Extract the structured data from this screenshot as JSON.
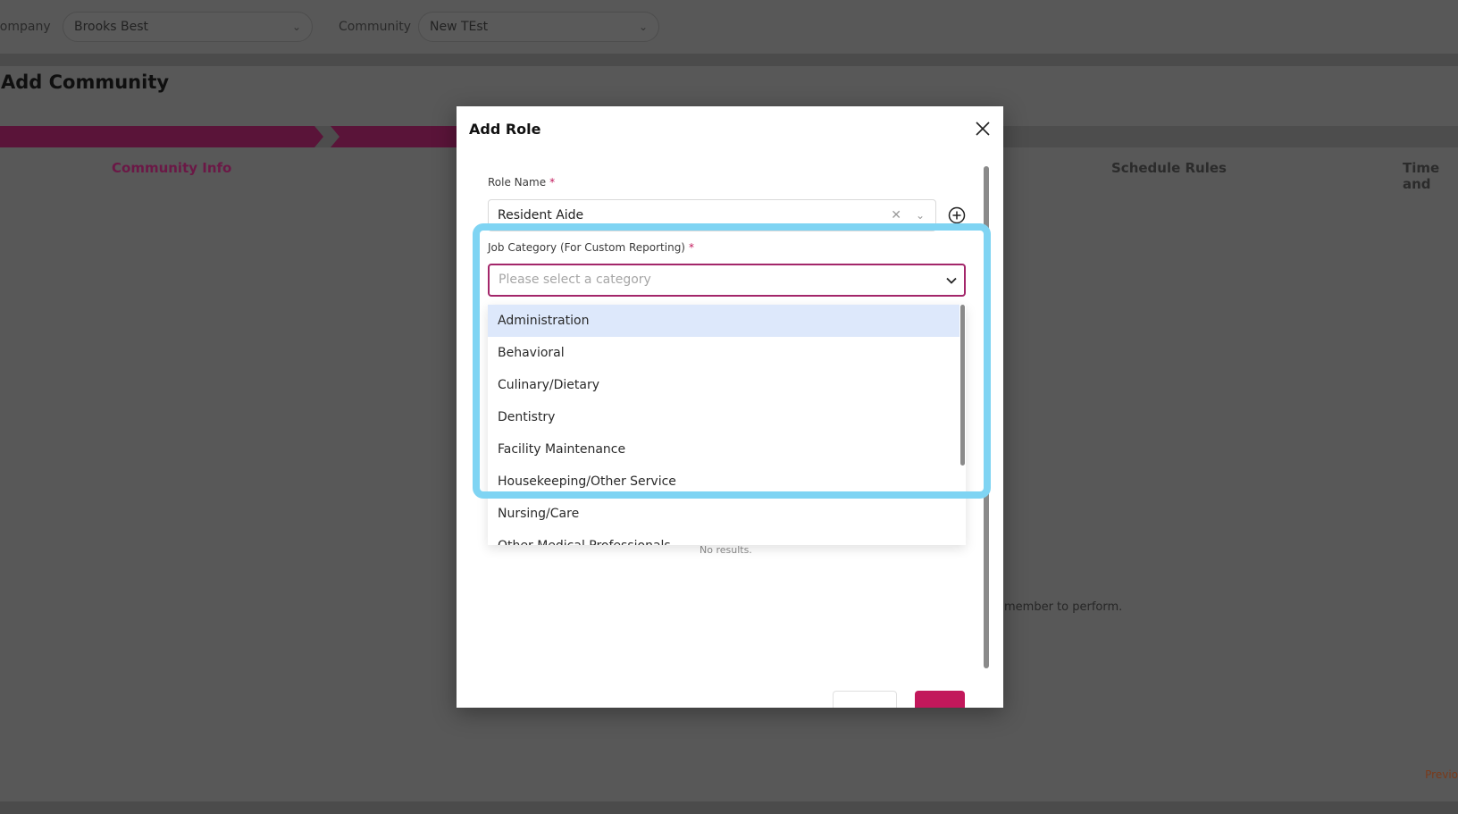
{
  "topbar": {
    "company_label": "Company",
    "company_value": "Brooks Best",
    "community_label": "Community",
    "community_value": "New TEst"
  },
  "page": {
    "title": "Add Community",
    "steps": [
      {
        "label": "Community Info"
      },
      {
        "label": "Schedule Rules"
      },
      {
        "label": "Time and"
      }
    ],
    "bg_hint": "member to perform.",
    "previous_label": "Previo"
  },
  "modal": {
    "title": "Add Role",
    "role_name_label": "Role Name",
    "role_name_value": "Resident Aide",
    "job_category_label": "Job Category (For Custom Reporting)",
    "job_category_placeholder": "Please select a category",
    "required_mark": "*",
    "no_results": "No results.",
    "options": [
      {
        "label": "Administration"
      },
      {
        "label": "Behavioral"
      },
      {
        "label": "Culinary/Dietary"
      },
      {
        "label": "Dentistry"
      },
      {
        "label": "Facility Maintenance"
      },
      {
        "label": "Housekeeping/Other Service"
      },
      {
        "label": "Nursing/Care"
      },
      {
        "label": "Other Medical Professionals"
      }
    ],
    "selected_option": "Administration"
  },
  "colors": {
    "accent": "#c2185b",
    "stepper_active": "#5a1439",
    "highlight": "#7fd4f3",
    "selected_option_bg": "#dde8fb"
  },
  "icons": {
    "close": "close-icon",
    "chevron": "chevron-down-icon",
    "clear": "clear-icon",
    "add": "add-circle-icon"
  }
}
